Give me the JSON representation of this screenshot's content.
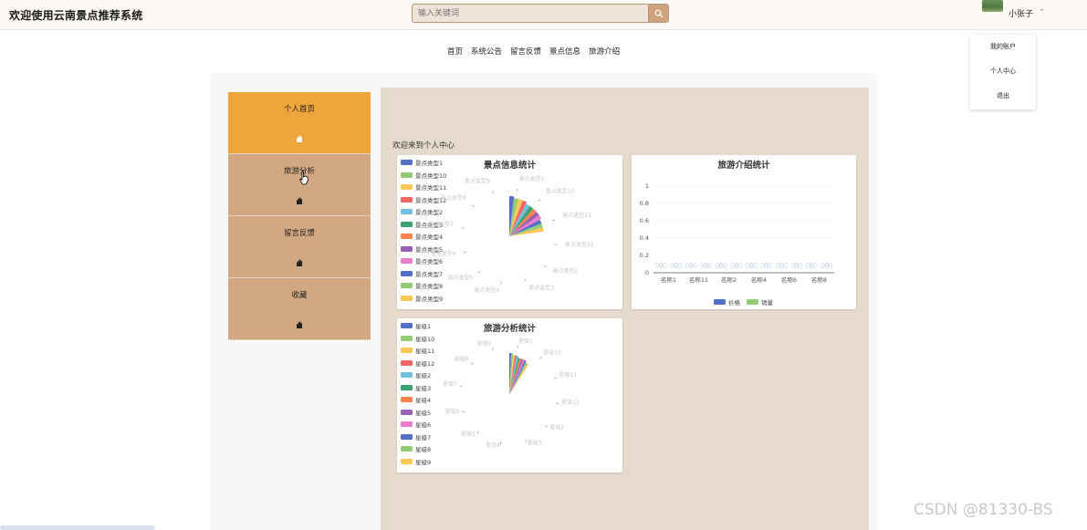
{
  "header": {
    "site_title": "欢迎使用云南景点推荐系统",
    "search_placeholder": "输入关键词",
    "user_name": "小张子",
    "caret": "-"
  },
  "user_menu": [
    "我的账户",
    "个人中心",
    "退出"
  ],
  "nav": [
    "首页",
    "系统公告",
    "留言反馈",
    "景点信息",
    "旅游介绍"
  ],
  "sidebar": [
    {
      "label": "个人首页",
      "active": true
    },
    {
      "label": "旅游分析",
      "active": false
    },
    {
      "label": "留言反馈",
      "active": false
    },
    {
      "label": "收藏",
      "active": false
    }
  ],
  "welcome_text": "欢迎来到个人中心",
  "colors": {
    "accent": "#eea53a",
    "side_bg": "#d2a882",
    "content_bg": "#e5dacc",
    "palette": [
      "#5470c6",
      "#91cc75",
      "#fac858",
      "#ee6666",
      "#73c0de",
      "#3ba272",
      "#fc8452",
      "#9a60b4",
      "#ea7ccc",
      "#5470c6",
      "#91cc75",
      "#fac858"
    ]
  },
  "watermark": "CSDN @81330-BS",
  "chart_data": [
    {
      "type": "pie",
      "title": "景点信息统计",
      "legend_position": "left",
      "legend": [
        "景点类型1",
        "景点类型10",
        "景点类型11",
        "景点类型12",
        "景点类型2",
        "景点类型3",
        "景点类型4",
        "景点类型5",
        "景点类型6",
        "景点类型7",
        "景点类型8",
        "景点类型9"
      ],
      "slice_labels": [
        "景点类型1",
        "景点类型10",
        "景点类型11",
        "景点类型12",
        "景点类型2",
        "景点类型3",
        "景点类型4",
        "景点类型5",
        "景点类型6",
        "景点类型7",
        "景点类型8",
        "景点类型9"
      ],
      "values": [
        10,
        9,
        9,
        9,
        8,
        8,
        8,
        8,
        8,
        7,
        7,
        7
      ]
    },
    {
      "type": "bar",
      "title": "旅游介绍统计",
      "categories": [
        "名称1",
        "名称11",
        "名称2",
        "名称4",
        "名称6",
        "名称8"
      ],
      "series": [
        {
          "name": "价格",
          "values": [
            0,
            0,
            0,
            0,
            0,
            0
          ]
        },
        {
          "name": "销量",
          "values": [
            0,
            0,
            0,
            0,
            0,
            0
          ]
        }
      ],
      "bar_value_label": "00",
      "y_ticks": [
        "1",
        "0.8",
        "0.6",
        "0.4",
        "0.2",
        "0"
      ],
      "ylim": [
        0,
        1
      ],
      "legend_position": "bottom"
    },
    {
      "type": "pie",
      "title": "旅游分析统计",
      "legend_position": "left",
      "legend": [
        "星级1",
        "星级10",
        "星级11",
        "星级12",
        "星级2",
        "星级3",
        "星级4",
        "星级5",
        "星级6",
        "星级7",
        "星级8",
        "星级9"
      ],
      "slice_labels": [
        "星级1",
        "星级10",
        "星级11",
        "星级12",
        "星级2",
        "星级3",
        "星级4",
        "星级5",
        "星级6",
        "星级7",
        "星级8",
        "星级9"
      ],
      "values": [
        10,
        10,
        9,
        9,
        9,
        8,
        8,
        8,
        8,
        8,
        7,
        7
      ]
    }
  ]
}
